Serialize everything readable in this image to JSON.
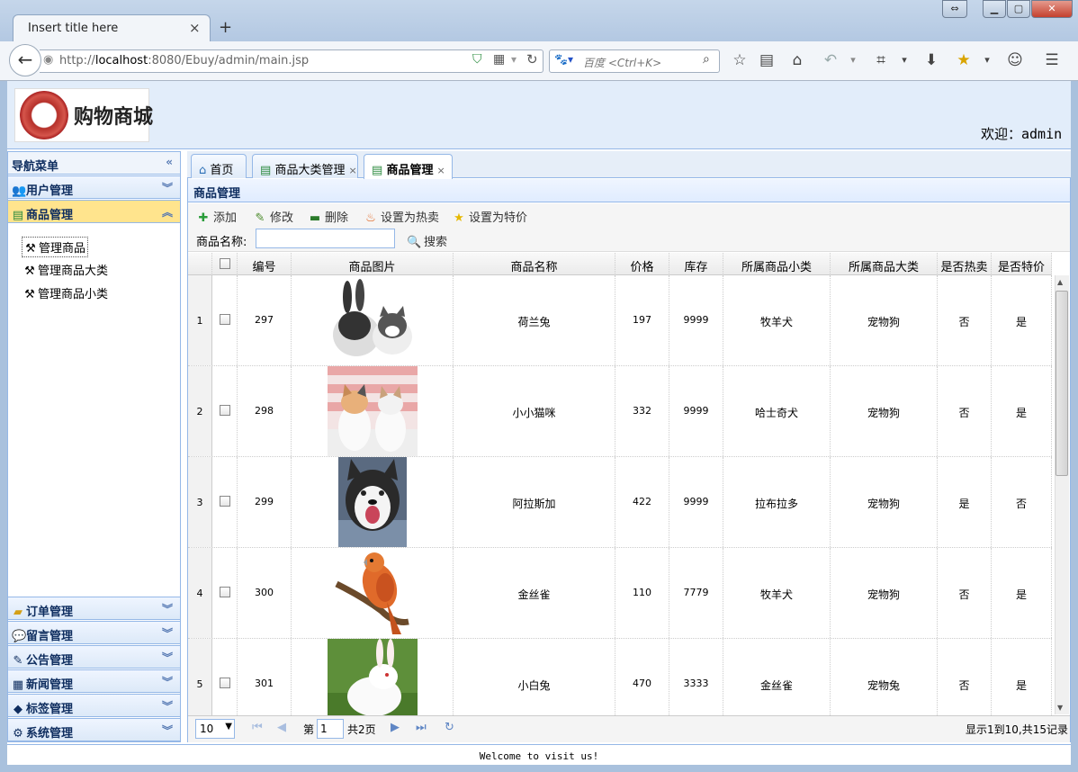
{
  "browser": {
    "tab_title": "Insert title here",
    "url_prefix": "http://",
    "url_host": "localhost",
    "url_path": ":8080/Ebuy/admin/main.jsp",
    "search_placeholder": "百度 <Ctrl+K>"
  },
  "header": {
    "logo_text": "购物商城",
    "welcome": "欢迎：admin"
  },
  "nav": {
    "title": "导航菜单",
    "sections": [
      {
        "label": "用户管理"
      },
      {
        "label": "商品管理"
      },
      {
        "label": "订单管理"
      },
      {
        "label": "留言管理"
      },
      {
        "label": "公告管理"
      },
      {
        "label": "新闻管理"
      },
      {
        "label": "标签管理"
      },
      {
        "label": "系统管理"
      }
    ],
    "items": [
      "管理商品",
      "管理商品大类",
      "管理商品小类"
    ]
  },
  "tabs": [
    "首页",
    "商品大类管理",
    "商品管理"
  ],
  "grid": {
    "title": "商品管理",
    "buttons": [
      "添加",
      "修改",
      "删除",
      "设置为热卖",
      "设置为特价"
    ],
    "search_label": "商品名称:",
    "search_button": "搜索",
    "columns": [
      "编号",
      "商品图片",
      "商品名称",
      "价格",
      "库存",
      "所属商品小类",
      "所属商品大类",
      "是否热卖",
      "是否特价"
    ],
    "rows": [
      {
        "n": "1",
        "id": "297",
        "name": "荷兰兔",
        "price": "197",
        "stock": "9999",
        "sub": "牧羊犬",
        "big": "宠物狗",
        "hot": "否",
        "special": "是"
      },
      {
        "n": "2",
        "id": "298",
        "name": "小小猫咪",
        "price": "332",
        "stock": "9999",
        "sub": "哈士奇犬",
        "big": "宠物狗",
        "hot": "否",
        "special": "是"
      },
      {
        "n": "3",
        "id": "299",
        "name": "阿拉斯加",
        "price": "422",
        "stock": "9999",
        "sub": "拉布拉多",
        "big": "宠物狗",
        "hot": "是",
        "special": "否"
      },
      {
        "n": "4",
        "id": "300",
        "name": "金丝雀",
        "price": "110",
        "stock": "7779",
        "sub": "牧羊犬",
        "big": "宠物狗",
        "hot": "否",
        "special": "是"
      },
      {
        "n": "5",
        "id": "301",
        "name": "小白兔",
        "price": "470",
        "stock": "3333",
        "sub": "金丝雀",
        "big": "宠物兔",
        "hot": "否",
        "special": "是"
      }
    ]
  },
  "pager": {
    "page_size": "10",
    "page_label": "第",
    "page_no": "1",
    "total_pages": "共2页",
    "summary": "显示1到10,共15记录"
  },
  "footer": "Welcome to visit us!"
}
